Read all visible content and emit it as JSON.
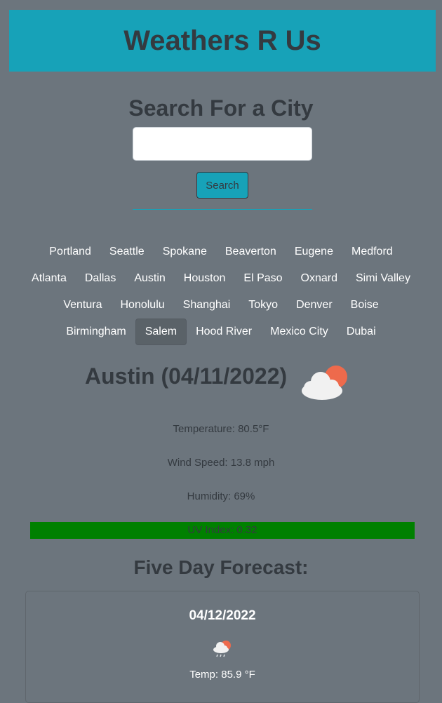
{
  "header": {
    "title": "Weathers R Us"
  },
  "search": {
    "title": "Search For a City",
    "input_value": "",
    "placeholder": "",
    "button_label": "Search"
  },
  "cities": [
    {
      "label": "Portland"
    },
    {
      "label": "Seattle"
    },
    {
      "label": "Spokane"
    },
    {
      "label": "Beaverton"
    },
    {
      "label": "Eugene"
    },
    {
      "label": "Medford"
    },
    {
      "label": "Atlanta"
    },
    {
      "label": "Dallas"
    },
    {
      "label": "Austin"
    },
    {
      "label": "Houston"
    },
    {
      "label": "El Paso"
    },
    {
      "label": "Oxnard"
    },
    {
      "label": "Simi Valley"
    },
    {
      "label": "Ventura"
    },
    {
      "label": "Honolulu"
    },
    {
      "label": "Shanghai"
    },
    {
      "label": "Tokyo"
    },
    {
      "label": "Denver"
    },
    {
      "label": "Boise"
    },
    {
      "label": "Birmingham"
    },
    {
      "label": "Salem",
      "active": true
    },
    {
      "label": "Hood River"
    },
    {
      "label": "Mexico City"
    },
    {
      "label": "Dubai"
    }
  ],
  "current": {
    "city_title": "Austin (04/11/2022)",
    "icon": "partly-cloudy-icon",
    "temperature": "Temperature: 80.5°F",
    "wind": "Wind Speed: 13.8 mph",
    "humidity": "Humidity: 69%",
    "uv": "UV Index: 0.32",
    "uv_color": "#008000"
  },
  "forecast": {
    "title": "Five Day Forecast:",
    "days": [
      {
        "date": "04/12/2022",
        "icon": "rain-sun-icon",
        "temp": "Temp: 85.9 °F"
      }
    ]
  },
  "colors": {
    "background": "#6c757d",
    "accent": "#17a2b8",
    "text": "#343a40"
  }
}
